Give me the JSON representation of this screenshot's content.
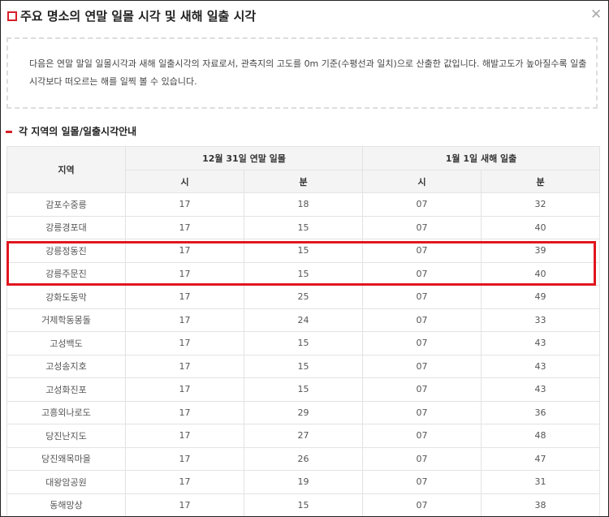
{
  "dialog": {
    "title": "주요 명소의 연말 일몰 시각 및 새해 일출 시각",
    "close_glyph": "✕"
  },
  "notice": {
    "text": "다음은 연말 말일 일몰시각과 새해 일출시각의 자료로서, 관측지의 고도를 0m 기준(수평선과 일치)으로 산출한 값입니다. 해발고도가 높아질수록 일출시각보다 떠오르는 해를 일찍 볼 수 있습니다."
  },
  "section": {
    "title": "각 지역의 일몰/일출시각안내"
  },
  "table": {
    "col_region": "지역",
    "group_sunset": "12월 31일 연말 일몰",
    "group_sunrise": "1월 1일 새해 일출",
    "col_hour": "시",
    "col_min": "분",
    "rows": [
      {
        "region": "감포수중릉",
        "ss_h": "17",
        "ss_m": "18",
        "sr_h": "07",
        "sr_m": "32"
      },
      {
        "region": "강릉경포대",
        "ss_h": "17",
        "ss_m": "15",
        "sr_h": "07",
        "sr_m": "40"
      },
      {
        "region": "강릉정동진",
        "ss_h": "17",
        "ss_m": "15",
        "sr_h": "07",
        "sr_m": "39"
      },
      {
        "region": "강릉주문진",
        "ss_h": "17",
        "ss_m": "15",
        "sr_h": "07",
        "sr_m": "40"
      },
      {
        "region": "강화도동막",
        "ss_h": "17",
        "ss_m": "25",
        "sr_h": "07",
        "sr_m": "49"
      },
      {
        "region": "거제학동몽돌",
        "ss_h": "17",
        "ss_m": "24",
        "sr_h": "07",
        "sr_m": "33"
      },
      {
        "region": "고성백도",
        "ss_h": "17",
        "ss_m": "15",
        "sr_h": "07",
        "sr_m": "43"
      },
      {
        "region": "고성송지호",
        "ss_h": "17",
        "ss_m": "15",
        "sr_h": "07",
        "sr_m": "43"
      },
      {
        "region": "고성화진포",
        "ss_h": "17",
        "ss_m": "15",
        "sr_h": "07",
        "sr_m": "43"
      },
      {
        "region": "고흥외나로도",
        "ss_h": "17",
        "ss_m": "29",
        "sr_h": "07",
        "sr_m": "36"
      },
      {
        "region": "당진난지도",
        "ss_h": "17",
        "ss_m": "27",
        "sr_h": "07",
        "sr_m": "48"
      },
      {
        "region": "당진왜목마을",
        "ss_h": "17",
        "ss_m": "26",
        "sr_h": "07",
        "sr_m": "47"
      },
      {
        "region": "대왕암공원",
        "ss_h": "17",
        "ss_m": "19",
        "sr_h": "07",
        "sr_m": "31"
      },
      {
        "region": "동해망상",
        "ss_h": "17",
        "ss_m": "15",
        "sr_h": "07",
        "sr_m": "38"
      }
    ]
  },
  "colors": {
    "accent": "#d7202a",
    "highlight": "#e0161e"
  }
}
